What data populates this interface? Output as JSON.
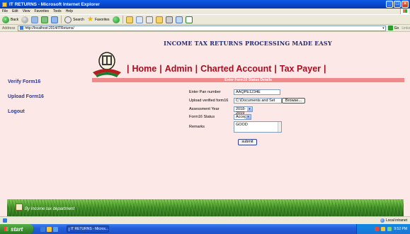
{
  "window": {
    "title": "IT RETURNS - Microsoft Internet Explorer"
  },
  "menu": [
    "File",
    "Edit",
    "View",
    "Favorites",
    "Tools",
    "Help"
  ],
  "toolbar": {
    "back_label": "Back",
    "search_label": "Search",
    "favorites_label": "Favorites"
  },
  "address": {
    "label": "Address",
    "url": "http://localhost:2014/ITReturns/",
    "go_label": "Go",
    "links_label": "Links"
  },
  "header": {
    "title": "INCOME TAX RETURNS PROCESSING MADE EASY",
    "nav": [
      "Home",
      "Admin",
      "Charted Account",
      "Tax Payer"
    ]
  },
  "section": {
    "title": "Enter Form16 Status Details"
  },
  "sidebar": {
    "items": [
      "Verify Form16",
      "Upload Form16",
      "Logout"
    ]
  },
  "form": {
    "pan_label": "Enter Pan number",
    "pan_value": "AAQPE1234E",
    "upload_label": "Upload verified form16",
    "upload_value": "C:\\Documents and Set",
    "browse_label": "Browse...",
    "year_label": "Assessment Year",
    "year_value": "2018-2019",
    "status_label": "Form16 Status",
    "status_value": "Accept",
    "remarks_label": "Remarks",
    "remarks_value": "GOOD",
    "submit_label": "submit"
  },
  "footer": {
    "text": "By Income tax department"
  },
  "status": {
    "zone": "Local intranet"
  },
  "taskbar": {
    "start_label": "start",
    "task_label": "IT RETURNS - Micros...",
    "clock": "9:52 PM"
  }
}
